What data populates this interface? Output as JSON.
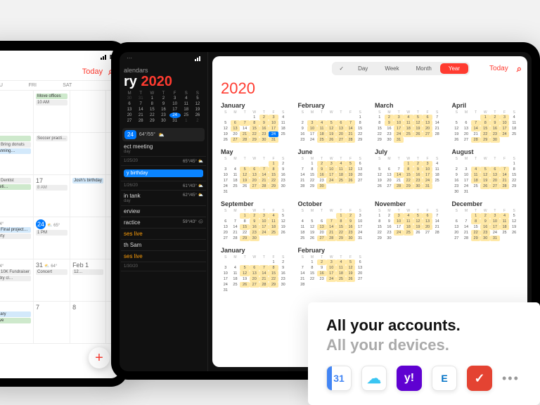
{
  "promo": {
    "line1": "All your accounts.",
    "line2": "All your devices.",
    "apps": {
      "gcal": "31",
      "yahoo": "y!",
      "exchange": "E",
      "todoist": "✓"
    }
  },
  "shared": {
    "today_label": "Today",
    "days3": [
      "THU",
      "FRI",
      "SAT"
    ],
    "days7": [
      "S",
      "M",
      "T",
      "W",
      "T",
      "F",
      "S"
    ]
  },
  "tabletA": {
    "rows": [
      [
        {
          "n": "",
          "ev": []
        },
        {
          "n": "",
          "ev": [
            {
              "cls": "g",
              "t": "",
              "x": "Move offices"
            },
            {
              "cls": "gr",
              "t": "",
              "x": "10 AM"
            }
          ]
        },
        {
          "n": "",
          "ev": []
        },
        {
          "n": "",
          "ev": []
        }
      ],
      [
        {
          "n": "",
          "ev": [
            {
              "cls": "g",
              "t": "",
              "x": "ding"
            },
            {
              "cls": "gr",
              "t": "8:30 AM",
              "x": "Bring donuts"
            },
            {
              "cls": "b",
              "t": "",
              "x": "Initial planning…"
            }
          ]
        },
        {
          "n": "",
          "ev": [
            {
              "cls": "gr",
              "t": "",
              "x": "Soccer practi…"
            }
          ]
        },
        {
          "n": "",
          "ev": []
        },
        {
          "n": "",
          "ev": []
        }
      ],
      [
        {
          "n": "",
          "ev": [
            {
              "cls": "gr",
              "t": "8:16 AM",
              "x": "Dentist"
            },
            {
              "cls": "g",
              "t": "",
              "x": "Staff meeti…"
            }
          ]
        },
        {
          "n": "17",
          "ev": [
            {
              "cls": "gr",
              "t": "8 AM",
              "x": ""
            }
          ]
        },
        {
          "n": "",
          "ev": [
            {
              "cls": "b",
              "t": "",
              "x": "Josh's birthday"
            }
          ]
        },
        {
          "n": "",
          "ev": []
        }
      ],
      [
        {
          "n": "23",
          "past": true,
          "wicon": true,
          "w": "64°",
          "ev": [
            {
              "cls": "b",
              "t": "6:30 AM",
              "x": "Final project…"
            },
            {
              "cls": "gr",
              "t": "",
              "x": "Pizza party"
            }
          ]
        },
        {
          "n": "24",
          "today": true,
          "wicon": true,
          "w": "65°",
          "ev": [
            {
              "cls": "gr",
              "t": "",
              "x": "1 PM"
            }
          ]
        },
        {
          "n": "",
          "ev": []
        },
        {
          "n": "",
          "ev": []
        }
      ],
      [
        {
          "n": "30",
          "wicon": true,
          "w": "64°",
          "ev": [
            {
              "cls": "gr",
              "t": "8:30 AM",
              "x": "10K Fundraiser"
            },
            {
              "cls": "gr",
              "t": "",
              "x": "Pick up dry cl…"
            }
          ]
        },
        {
          "n": "31",
          "wicon": true,
          "w": "64°",
          "ev": [
            {
              "cls": "gr",
              "t": "",
              "x": "Concert"
            }
          ]
        },
        {
          "n": "Feb 1",
          "ev": [
            {
              "cls": "gr",
              "t": "",
              "x": "12…"
            }
          ]
        },
        {
          "n": "",
          "ev": []
        }
      ],
      [
        {
          "n": "6",
          "ev": [
            {
              "cls": "b",
              "t": "",
              "x": "Anniversary"
            },
            {
              "cls": "g",
              "t": "",
              "x": "Food drive"
            }
          ]
        },
        {
          "n": "7",
          "ev": []
        },
        {
          "n": "8",
          "ev": []
        },
        {
          "n": "",
          "ev": []
        }
      ]
    ]
  },
  "tabletB": {
    "calendars_label": "alendars",
    "month": "ry",
    "year": "2020",
    "mini_dow": [
      "M",
      "T",
      "W",
      "T",
      "F",
      "S",
      "S"
    ],
    "mini_rows": [
      [
        "30",
        "31",
        "1",
        "2",
        "3",
        "4",
        "5"
      ],
      [
        "6",
        "7",
        "8",
        "9",
        "10",
        "11",
        "12"
      ],
      [
        "13",
        "14",
        "15",
        "16",
        "17",
        "18",
        "19"
      ],
      [
        "20",
        "21",
        "22",
        "23",
        "24",
        "25",
        "26"
      ],
      [
        "27",
        "28",
        "29",
        "30",
        "31",
        "1",
        "2"
      ]
    ],
    "selected": {
      "pill": "24",
      "weather": "64°/55°"
    },
    "list": [
      {
        "ttl": "ect meeting",
        "sub": "day"
      },
      {
        "ttl": "",
        "sub": "1/25/20",
        "r": "65°/45°",
        "w": "⛅"
      },
      {
        "bd": "y birthday"
      },
      {
        "ttl": "",
        "sub": "1/26/20",
        "r": "61°/43°",
        "w": "⛅"
      },
      {
        "ttl": "in tank",
        "sub": "day",
        "r": "62°/45°",
        "w": "⛅"
      },
      {
        "ttl": "erview",
        "sub": ""
      },
      {
        "ttl": "ractice",
        "sub": "",
        "r": "59°/43°",
        "w": "🌧"
      },
      {
        "live": "ses live"
      },
      {
        "ttl": "th Sam",
        "sub": ""
      },
      {
        "live": "ses live"
      },
      {
        "ttl": "",
        "sub": "1/30/20"
      }
    ]
  },
  "year": {
    "title": "2020",
    "seg": [
      "✓",
      "Day",
      "Week",
      "Month",
      "Year"
    ],
    "months": [
      {
        "name": "January",
        "skip": 3,
        "days": 31,
        "hi": [
          2,
          3,
          6,
          7,
          8,
          9,
          10,
          13,
          15,
          16,
          17,
          21,
          22,
          23,
          27,
          28,
          29,
          30,
          31
        ],
        "cur": 24
      },
      {
        "name": "February",
        "skip": 6,
        "days": 29,
        "hi": [
          3,
          4,
          5,
          6,
          7,
          10,
          11,
          12,
          13,
          14,
          18,
          19,
          20,
          21,
          25,
          26,
          27,
          28
        ]
      },
      {
        "name": "March",
        "skip": 0,
        "days": 31,
        "hi": [
          2,
          3,
          4,
          5,
          6,
          9,
          10,
          11,
          12,
          13,
          17,
          18,
          19,
          20,
          24,
          25,
          26,
          27,
          31
        ]
      },
      {
        "name": "April",
        "skip": 3,
        "days": 30,
        "hi": [
          1,
          2,
          3,
          7,
          8,
          9,
          10,
          14,
          15,
          16,
          17,
          22,
          23,
          24,
          28,
          29,
          30
        ]
      },
      {
        "name": "May",
        "skip": 5,
        "days": 31,
        "hi": [
          1,
          5,
          6,
          7,
          8,
          12,
          13,
          14,
          15,
          19,
          20,
          21,
          22,
          27,
          28,
          29
        ]
      },
      {
        "name": "June",
        "skip": 1,
        "days": 30,
        "hi": [
          2,
          3,
          4,
          5,
          9,
          10,
          11,
          12,
          16,
          17,
          18,
          19,
          24,
          25,
          26,
          30
        ]
      },
      {
        "name": "July",
        "skip": 3,
        "days": 31,
        "hi": [
          1,
          2,
          3,
          8,
          9,
          10,
          14,
          15,
          16,
          17,
          22,
          23,
          24,
          28,
          29,
          30,
          31
        ]
      },
      {
        "name": "August",
        "skip": 6,
        "days": 31,
        "hi": [
          4,
          5,
          6,
          7,
          11,
          12,
          13,
          14,
          18,
          19,
          20,
          21,
          26,
          27,
          28
        ]
      },
      {
        "name": "September",
        "skip": 2,
        "days": 30,
        "hi": [
          1,
          2,
          3,
          4,
          9,
          10,
          11,
          15,
          16,
          17,
          18,
          23,
          24,
          25,
          29,
          30
        ]
      },
      {
        "name": "October",
        "skip": 4,
        "days": 31,
        "hi": [
          1,
          2,
          7,
          8,
          9,
          13,
          14,
          15,
          16,
          21,
          22,
          23,
          27,
          28,
          29,
          30
        ]
      },
      {
        "name": "November",
        "skip": 0,
        "days": 30,
        "hi": [
          3,
          4,
          5,
          6,
          10,
          11,
          12,
          13,
          18,
          19,
          20,
          24,
          25
        ]
      },
      {
        "name": "December",
        "skip": 2,
        "days": 31,
        "hi": [
          1,
          2,
          3,
          4,
          8,
          9,
          10,
          11,
          16,
          17,
          18,
          22,
          23,
          29,
          30,
          31
        ]
      },
      {
        "name": "January",
        "skip": 5,
        "days": 31,
        "hi": [
          5,
          6,
          7,
          8,
          12,
          13,
          14,
          15,
          20,
          21,
          22,
          26,
          27,
          28,
          29
        ]
      },
      {
        "name": "February",
        "skip": 1,
        "days": 28,
        "hi": [
          2,
          3,
          4,
          5,
          10,
          11,
          12,
          16,
          17,
          18,
          19,
          24,
          25,
          26
        ]
      }
    ]
  }
}
